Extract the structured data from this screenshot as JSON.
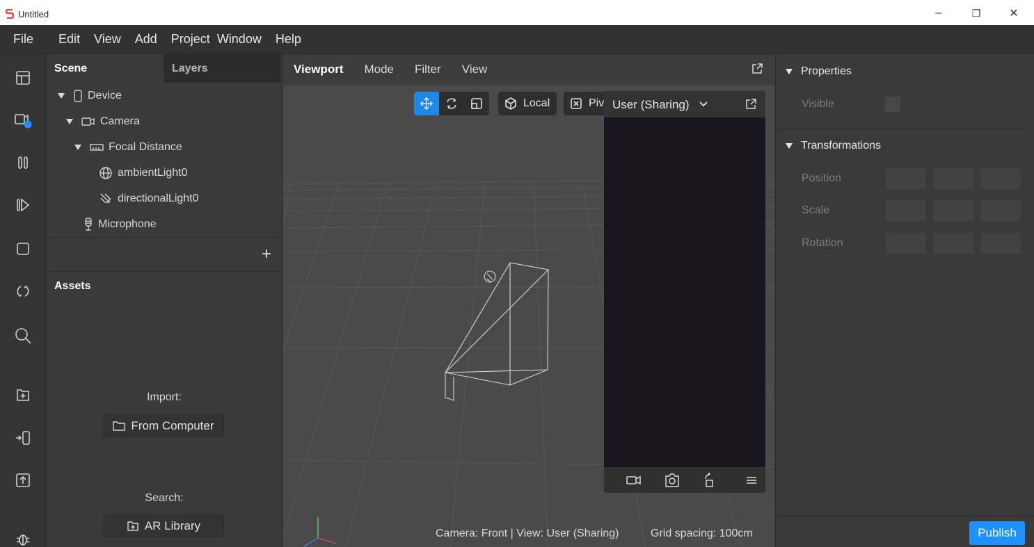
{
  "window": {
    "title": "Untitled",
    "minimize": "–",
    "restore": "❐",
    "close": "✕"
  },
  "menu": [
    "File",
    "Edit",
    "View",
    "Add",
    "Project",
    "Window",
    "Help"
  ],
  "scene_panel": {
    "tabs": [
      "Scene",
      "Layers"
    ],
    "tree": [
      {
        "label": "Device",
        "icon": "phone-icon"
      },
      {
        "label": "Camera",
        "icon": "camera-icon"
      },
      {
        "label": "Focal Distance",
        "icon": "ruler-icon"
      },
      {
        "label": "ambientLight0",
        "icon": "globe-icon"
      },
      {
        "label": "directionalLight0",
        "icon": "directional-light-icon"
      },
      {
        "label": "Microphone",
        "icon": "microphone-icon"
      }
    ],
    "add_label": "+"
  },
  "assets_panel": {
    "title": "Assets",
    "import_label": "Import:",
    "from_computer": "From Computer",
    "search_label": "Search:",
    "ar_library": "AR Library"
  },
  "viewport": {
    "tabs": [
      "Viewport",
      "Mode",
      "Filter",
      "View"
    ],
    "toolbar": {
      "local": "Local",
      "pivot": "Piv"
    },
    "preview_selector": "User (Sharing)",
    "status": "Camera: Front | View: User (Sharing)",
    "grid": "Grid spacing: 100cm"
  },
  "properties": {
    "section1": "Properties",
    "visible": "Visible",
    "section2": "Transformations",
    "position": "Position",
    "scale": "Scale",
    "rotation": "Rotation",
    "publish": "Publish"
  },
  "colors": {
    "accent": "#1e88e5",
    "publish": "#1e90ff",
    "badge": "#1e90ff"
  }
}
